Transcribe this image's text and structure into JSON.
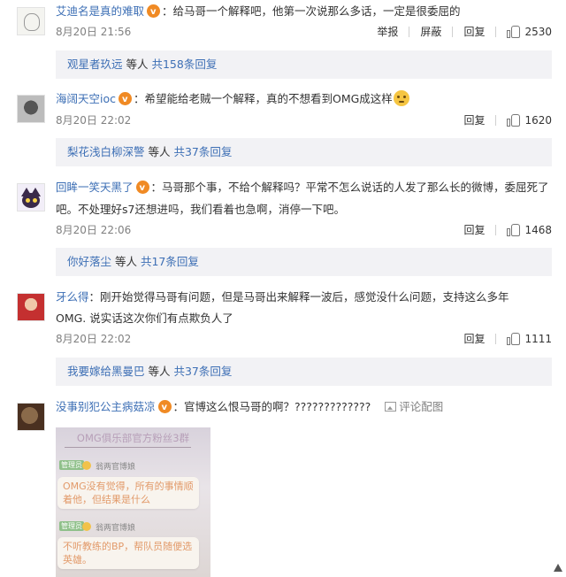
{
  "comments": [
    {
      "user": "艾迪名是真的难取",
      "text": "：给马哥一个解释吧，他第一次说那么多话，一定是很委屈的",
      "time": "8月20日 21:56",
      "actions": [
        "举报",
        "屏蔽",
        "回复"
      ],
      "likes": "2530",
      "replies": {
        "who": "观星者玖远",
        "mid": " 等人 ",
        "count": "共158条回复"
      }
    },
    {
      "user": "海阔天空ioc",
      "text": "：希望能给老贼一个解释，真的不想看到OMG成这样",
      "time": "8月20日 22:02",
      "actions": [
        "回复"
      ],
      "likes": "1620",
      "replies": {
        "who": "梨花浅白柳深警",
        "mid": " 等人 ",
        "count": "共37条回复"
      }
    },
    {
      "user": "回眸一笑天黑了",
      "text_line1": "：马哥那个事，不给个解释吗？平常不怎么说话的人发了那么长的微博，委屈死了",
      "text_line2": "吧。不处理好s7还想进吗，我们看着也急啊，消停一下吧。",
      "time": "8月20日 22:06",
      "actions": [
        "回复"
      ],
      "likes": "1468",
      "replies": {
        "who": "你好落尘",
        "mid": " 等人 ",
        "count": "共17条回复"
      }
    },
    {
      "user": "牙么得",
      "text_line1": "：刚开始觉得马哥有问题，但是马哥出来解释一波后，感觉没什么问题，支持这么多年",
      "text_line2": "OMG. 说实话这次你们有点欺负人了",
      "time": "8月20日 22:02",
      "actions": [
        "回复"
      ],
      "likes": "1111",
      "replies": {
        "who": "我要嫁给黑曼巴",
        "mid": " 等人 ",
        "count": "共37条回复"
      }
    },
    {
      "user": "没事别犯公主病菇凉",
      "text": "：官博这么恨马哥的啊？?????????????",
      "pic_label": "评论配图"
    }
  ],
  "screenshot": {
    "title": "OMG俱乐部官方粉丝3群",
    "tag": "管理员",
    "name": "翁两官博娘",
    "msg1": "OMG没有觉得，所有的事情顺着他，但结果是什么",
    "msg2": "不听教练的BP，帮队员随便选英雄。"
  },
  "colors": {
    "link": "#3d6fb5",
    "reply_bg": "#f2f2f5",
    "vip": "#f08a24"
  }
}
